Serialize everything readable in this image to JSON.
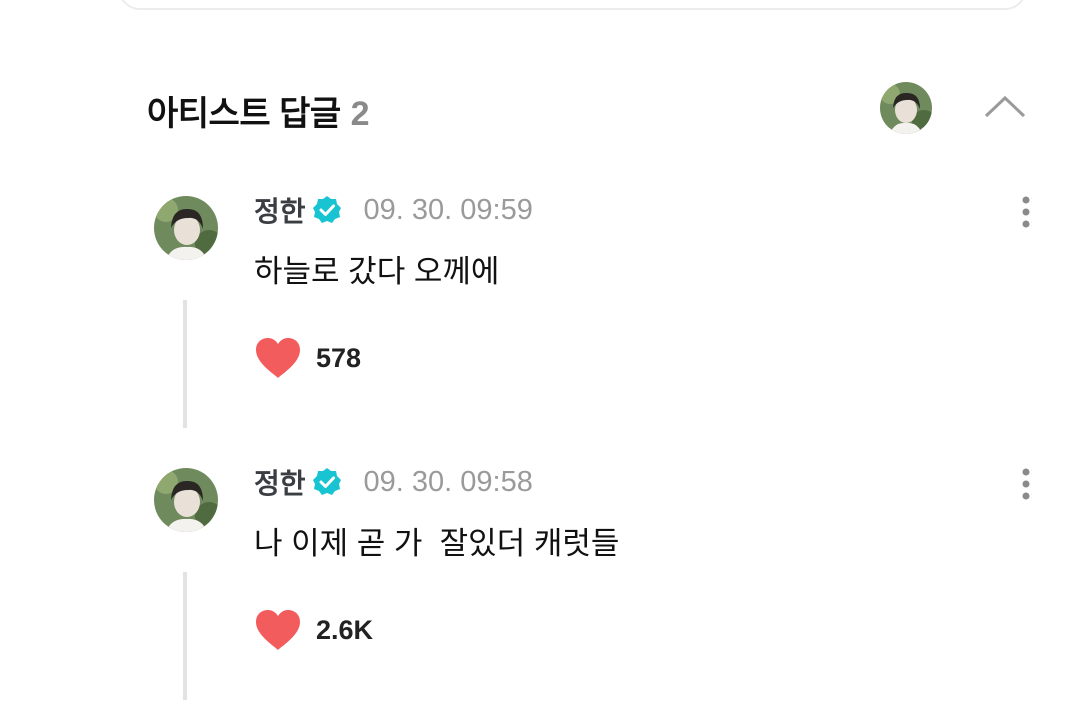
{
  "section": {
    "title": "아티스트 답글",
    "count": "2"
  },
  "comments": [
    {
      "author": "정한",
      "time": "09. 30. 09:59",
      "text": "하늘로 갔다 오께에",
      "likes": "578"
    },
    {
      "author": "정한",
      "time": "09. 30. 09:58",
      "text": "나 이제 곧 가  잘있더 캐럿들",
      "likes": "2.6K"
    }
  ],
  "colors": {
    "verified": "#19c4d2",
    "heart": "#f25c5c",
    "muted": "#9a9a9a"
  },
  "icons": [
    "chevron-up-icon",
    "verified-badge-icon",
    "more-vertical-icon",
    "heart-icon"
  ]
}
